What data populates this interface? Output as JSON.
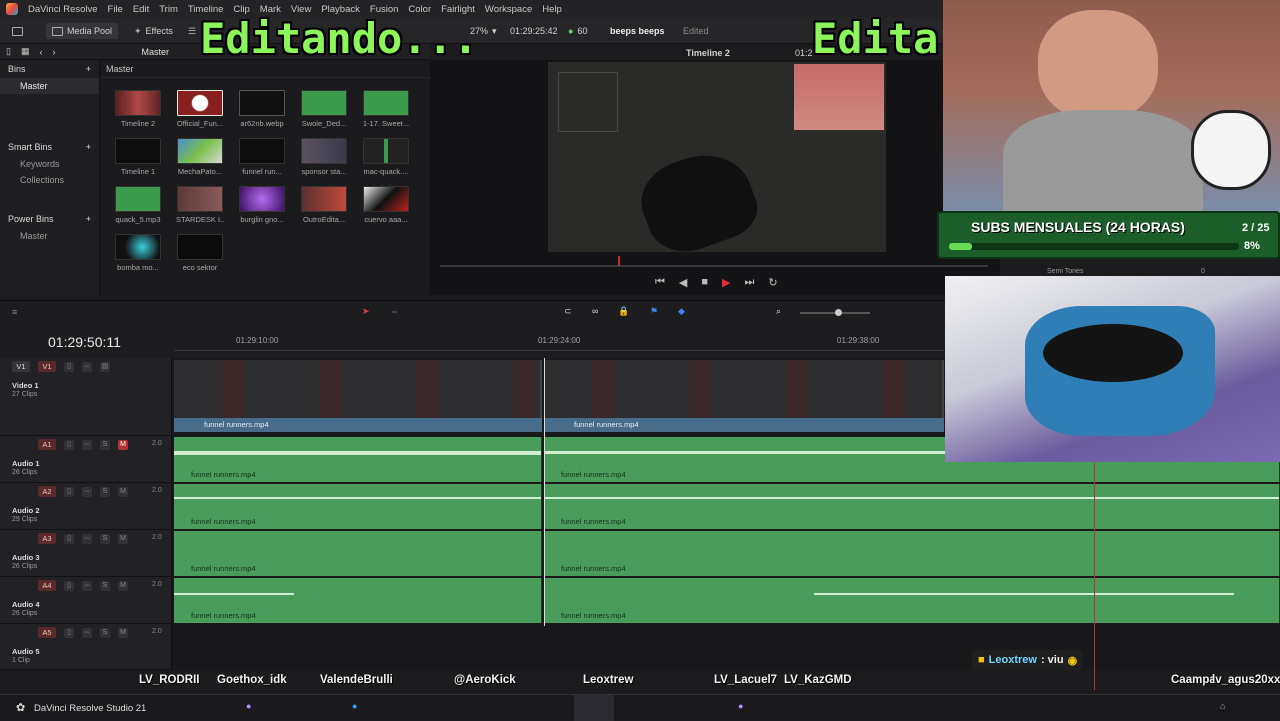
{
  "menu": {
    "app_name": "DaVinci Resolve",
    "items": [
      "File",
      "Edit",
      "Trim",
      "Timeline",
      "Clip",
      "Mark",
      "View",
      "Playback",
      "Fusion",
      "Color",
      "Fairlight",
      "Workspace",
      "Help"
    ]
  },
  "toolbar": {
    "media_pool": "Media Pool",
    "effects": "Effects",
    "project_name": "beeps beeps",
    "project_status": "Edited",
    "zoom": "27%",
    "src_timecode": "01:29:25:42",
    "fps": "60",
    "timeline_name": "Timeline 2",
    "right_timecode": "01:2"
  },
  "subbar": {
    "master": "Master"
  },
  "bins": {
    "title": "Bins",
    "master": "Master",
    "smart_title": "Smart Bins",
    "keywords": "Keywords",
    "collections": "Collections",
    "power_title": "Power Bins",
    "power_master": "Master"
  },
  "pool": {
    "header": "Master",
    "clips": [
      "Timeline 2",
      "Official_Fun...",
      "ar62nb.webp",
      "Swole_Ded...",
      "1-17. Sweet...",
      "Timeline 1",
      "MechaPato...",
      "funnel run...",
      "sponsor sta...",
      "mac-quack....",
      "quack_5.mp3",
      "STARDESK I...",
      "burglin gno...",
      "OutroEdita...",
      "cuervo aaa...",
      "bomba mo...",
      "eco sektor"
    ]
  },
  "timeline": {
    "timecode": "01:29:50:11",
    "ruler": [
      "01:29:10:00",
      "01:29:24:00",
      "01:29:38:00"
    ],
    "clip_name": "funnel runners.mp4",
    "tracks": [
      {
        "tag": "V1",
        "name": "Video 1",
        "count": "27 Clips"
      },
      {
        "tag": "A1",
        "name": "Audio 1",
        "count": "26 Clips",
        "vol": "2.0"
      },
      {
        "tag": "A2",
        "name": "Audio 2",
        "count": "29 Clips",
        "vol": "2.0"
      },
      {
        "tag": "A3",
        "name": "Audio 3",
        "count": "26 Clips",
        "vol": "2.0"
      },
      {
        "tag": "A4",
        "name": "Audio 4",
        "count": "26 Clips",
        "vol": "2.0"
      },
      {
        "tag": "A5",
        "name": "Audio 5",
        "count": "1 Clip",
        "vol": "2.0"
      }
    ]
  },
  "overlay": {
    "editing_left": "Editando...",
    "editing_right": "Edita",
    "subs_title": "SUBS MENSUALES (24 HORAS)",
    "subs_count": "2 / 25",
    "subs_percent": "8%",
    "subs_progress": 0.08,
    "semi_tones": "Semi Tones",
    "semi_val": "0"
  },
  "chat": {
    "user": "Leoxtrew",
    "message": ": viu"
  },
  "viewers": [
    "LV_RODRII",
    "Goethox_idk",
    "ValendeBrulli",
    "@AeroKick",
    "Leoxtrew",
    "LV_Lacuel7",
    "LV_KazGMD",
    "Caampa",
    "lv_agus20xx"
  ],
  "taskbar": {
    "title": "DaVinci Resolve Studio 21"
  },
  "colors": {
    "accent_green": "#8cf55a",
    "audio_clip": "#4a9c5b",
    "video_label": "#486d8a",
    "playhead": "#c03030"
  }
}
